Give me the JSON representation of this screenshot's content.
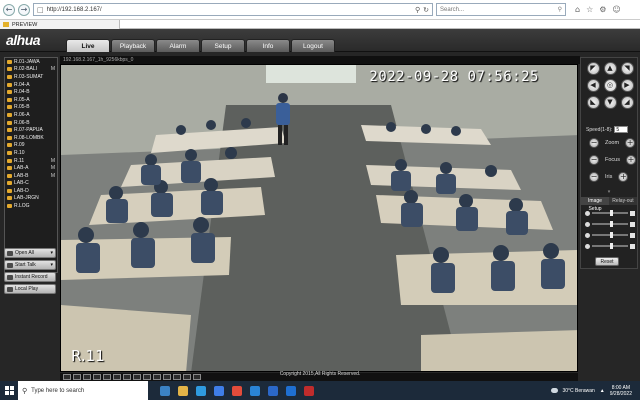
{
  "browser": {
    "address": "http://192.168.2.167/",
    "search_placeholder": "Search...",
    "tab_title": "PREVIEW"
  },
  "app": {
    "logo": "alhua",
    "nav": [
      "Live",
      "Playback",
      "Alarm",
      "Setup",
      "Info",
      "Logout"
    ],
    "active_nav": "Live"
  },
  "channels": [
    {
      "label": "R.01-JAWA",
      "tag": ""
    },
    {
      "label": "R.02-BALI",
      "tag": "M"
    },
    {
      "label": "R.03-SUMAT",
      "tag": ""
    },
    {
      "label": "R.04-A",
      "tag": ""
    },
    {
      "label": "R.04-B",
      "tag": ""
    },
    {
      "label": "R.05-A",
      "tag": ""
    },
    {
      "label": "R.05-B",
      "tag": ""
    },
    {
      "label": "R.06-A",
      "tag": ""
    },
    {
      "label": "R.06-B",
      "tag": ""
    },
    {
      "label": "R.07-PAPUA",
      "tag": ""
    },
    {
      "label": "R.08-LOMBK",
      "tag": ""
    },
    {
      "label": "R.09",
      "tag": ""
    },
    {
      "label": "R.10",
      "tag": ""
    },
    {
      "label": "R.11",
      "tag": "M"
    },
    {
      "label": "LAB-A",
      "tag": "M"
    },
    {
      "label": "LAB-B",
      "tag": "M"
    },
    {
      "label": "LAB-C",
      "tag": ""
    },
    {
      "label": "LAB-D",
      "tag": ""
    },
    {
      "label": "LAB-JRGN",
      "tag": ""
    },
    {
      "label": "R.LOG",
      "tag": ""
    }
  ],
  "left_buttons": {
    "open_all": "Open All",
    "start_talk": "Start Talk",
    "instant_record": "Instant Record",
    "local_play": "Local Play"
  },
  "video": {
    "stream_info": "192.168.2.167_1h_9256kbps_0",
    "timestamp": "2022-09-28 07:56:25",
    "camera_name": "R.11"
  },
  "ptz": {
    "speed_label": "Speed(1-8):",
    "speed_value": "5",
    "zoom_label": "Zoom",
    "focus_label": "Focus",
    "iris_label": "Iris",
    "image_setup_tab": "Image Setup",
    "relay_out_tab": "Relay-out",
    "reset_label": "Reset"
  },
  "footer": {
    "copyright": "Copyright 2015,All Rights Reserved."
  },
  "taskbar": {
    "search_placeholder": "Type here to search",
    "weather": "30°C  Berawan",
    "time": "8:00 AM",
    "date": "9/28/2022"
  }
}
